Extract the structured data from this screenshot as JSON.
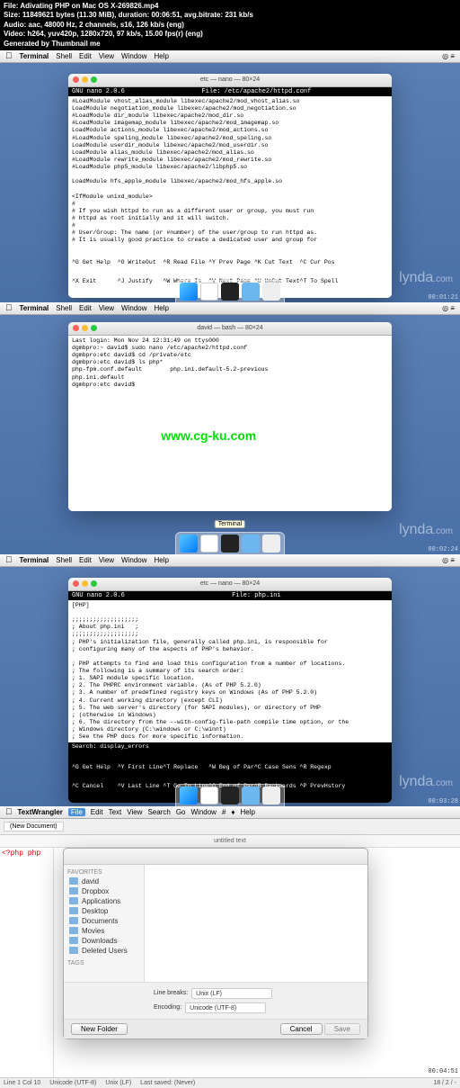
{
  "header": {
    "l1": "File: Adivating PHP on Mac OS X-269826.mp4",
    "l2": "Size: 11849621 bytes (11.30 MiB), duration: 00:06:51, avg.bitrate: 231 kb/s",
    "l3": "Audio: aac, 48000 Hz, 2 channels, s16, 126 kb/s (eng)",
    "l4": "Video: h264, yuv420p, 1280x720, 97 kb/s, 15.00 fps(r) (eng)",
    "l5": "Generated by Thumbnail me"
  },
  "menubar": {
    "app": "Terminal",
    "items": [
      "Shell",
      "Edit",
      "View",
      "Window",
      "Help"
    ]
  },
  "watermark": {
    "brand": "lynda",
    "ext": ".com"
  },
  "s1": {
    "title": "etc — nano — 80×24",
    "nano_ver": "GNU nano 2.0.6",
    "nano_file": "File: /etc/apache2/httpd.conf",
    "content": "#LoadModule vhost_alias_module libexec/apache2/mod_vhost_alias.so\nLoadModule negotiation_module libexec/apache2/mod_negotiation.so\n#LoadModule dir_module libexec/apache2/mod_dir.so\n#LoadModule imagemap_module libexec/apache2/mod_imagemap.so\nLoadModule actions_module libexec/apache2/mod_actions.so\n#LoadModule speling_module libexec/apache2/mod_speling.so\nLoadModule userdir_module libexec/apache2/mod_userdir.so\nLoadModule alias_module libexec/apache2/mod_alias.so\n#LoadModule rewrite_module libexec/apache2/mod_rewrite.so\n#LoadModule php5_module libexec/apache2/libphp5.so\n\nLoadModule hfs_apple_module libexec/apache2/mod_hfs_apple.so\n\n<IfModule unixd_module>\n#\n# If you wish httpd to run as a different user or group, you must run\n# httpd as root initially and it will switch.\n#\n# User/Group: The name (or #number) of the user/group to run httpd as.\n# It is usually good practice to create a dedicated user and group for",
    "footer_l1": "^G Get Help  ^O WriteOut  ^R Read File ^Y Prev Page ^K Cut Text  ^C Cur Pos",
    "footer_l2": "^X Exit      ^J Justify   ^W Where Is  ^V Next Page ^U UnCut Text^T To Spell",
    "time": "00:01:21"
  },
  "s2": {
    "title": "david — bash — 80×24",
    "content": "Last login: Mon Nov 24 12:31:49 on ttys000\ndgmbpro:~ david$ sudo nano /etc/apache2/httpd.conf\ndgmbpro:etc david$ cd /private/etc\ndgmbpro:etc david$ ls php*\nphp-fpm.conf.default        php.ini.default-5.2-previous\nphp.ini.default\ndgmbpro:etc david$ ",
    "tiplabel": "Terminal",
    "cg": "www.cg-ku.com",
    "time": "00:02:24"
  },
  "s3": {
    "title": "etc — nano — 80×24",
    "nano_ver": "GNU nano 2.0.6",
    "nano_file": "File: php.ini",
    "content": "[PHP]\n\n;;;;;;;;;;;;;;;;;;;\n; About php.ini   ;\n;;;;;;;;;;;;;;;;;;;\n; PHP's initialization file, generally called php.ini, is responsible for\n; configuring many of the aspects of PHP's behavior.\n\n; PHP attempts to find and load this configuration from a number of locations.\n; The following is a summary of its search order:\n; 1. SAPI module specific location.\n; 2. The PHPRC environment variable. (As of PHP 5.2.0)\n; 3. A number of predefined registry keys on Windows (As of PHP 5.2.0)\n; 4. Current working directory (except CLI)\n; 5. The web server's directory (for SAPI modules), or directory of PHP\n; (otherwise in Windows)\n; 6. The directory from the --with-config-file-path compile time option, or the\n; Windows directory (C:\\windows or C:\\winnt)\n; See the PHP docs for more specific information.",
    "search": "Search: display_errors",
    "footer_l1": "^G Get Help  ^Y First Line^T Replace   ^W Beg of Par^C Case Sens ^R Regexp",
    "footer_l2": "^C Cancel    ^V Last Line ^T Go To Line^O End of Par^B Backwards ^P PrevHstory",
    "time": "00:03:28"
  },
  "s4": {
    "menubar_app": "TextWrangler",
    "menubar_items": [
      "File",
      "Edit",
      "Text",
      "View",
      "Search",
      "Go",
      "Window",
      "#",
      "♦",
      "Help"
    ],
    "toolbar_btn": "(New Document)",
    "doc_title": "untitled text",
    "code": "<?php php",
    "sidebar_hdr": "Favorites",
    "sidebar_items": [
      "david",
      "Dropbox",
      "Applications",
      "Desktop",
      "Documents",
      "Movies",
      "Downloads",
      "Deleted Users"
    ],
    "sidebar_tags": "Tags",
    "linebreaks_label": "Line breaks:",
    "linebreaks_val": "Unix (LF)",
    "encoding_label": "Encoding:",
    "encoding_val": "Unicode (UTF-8)",
    "newfolder": "New Folder",
    "cancel": "Cancel",
    "save": "Save",
    "status": {
      "l": "Line 1 Col 10",
      "m1": "Unicode (UTF-8)",
      "m2": "Unix (LF)",
      "r": "Last saved: (Never)",
      "sz": "18 / 2 / -"
    },
    "time": "00:04:51"
  }
}
